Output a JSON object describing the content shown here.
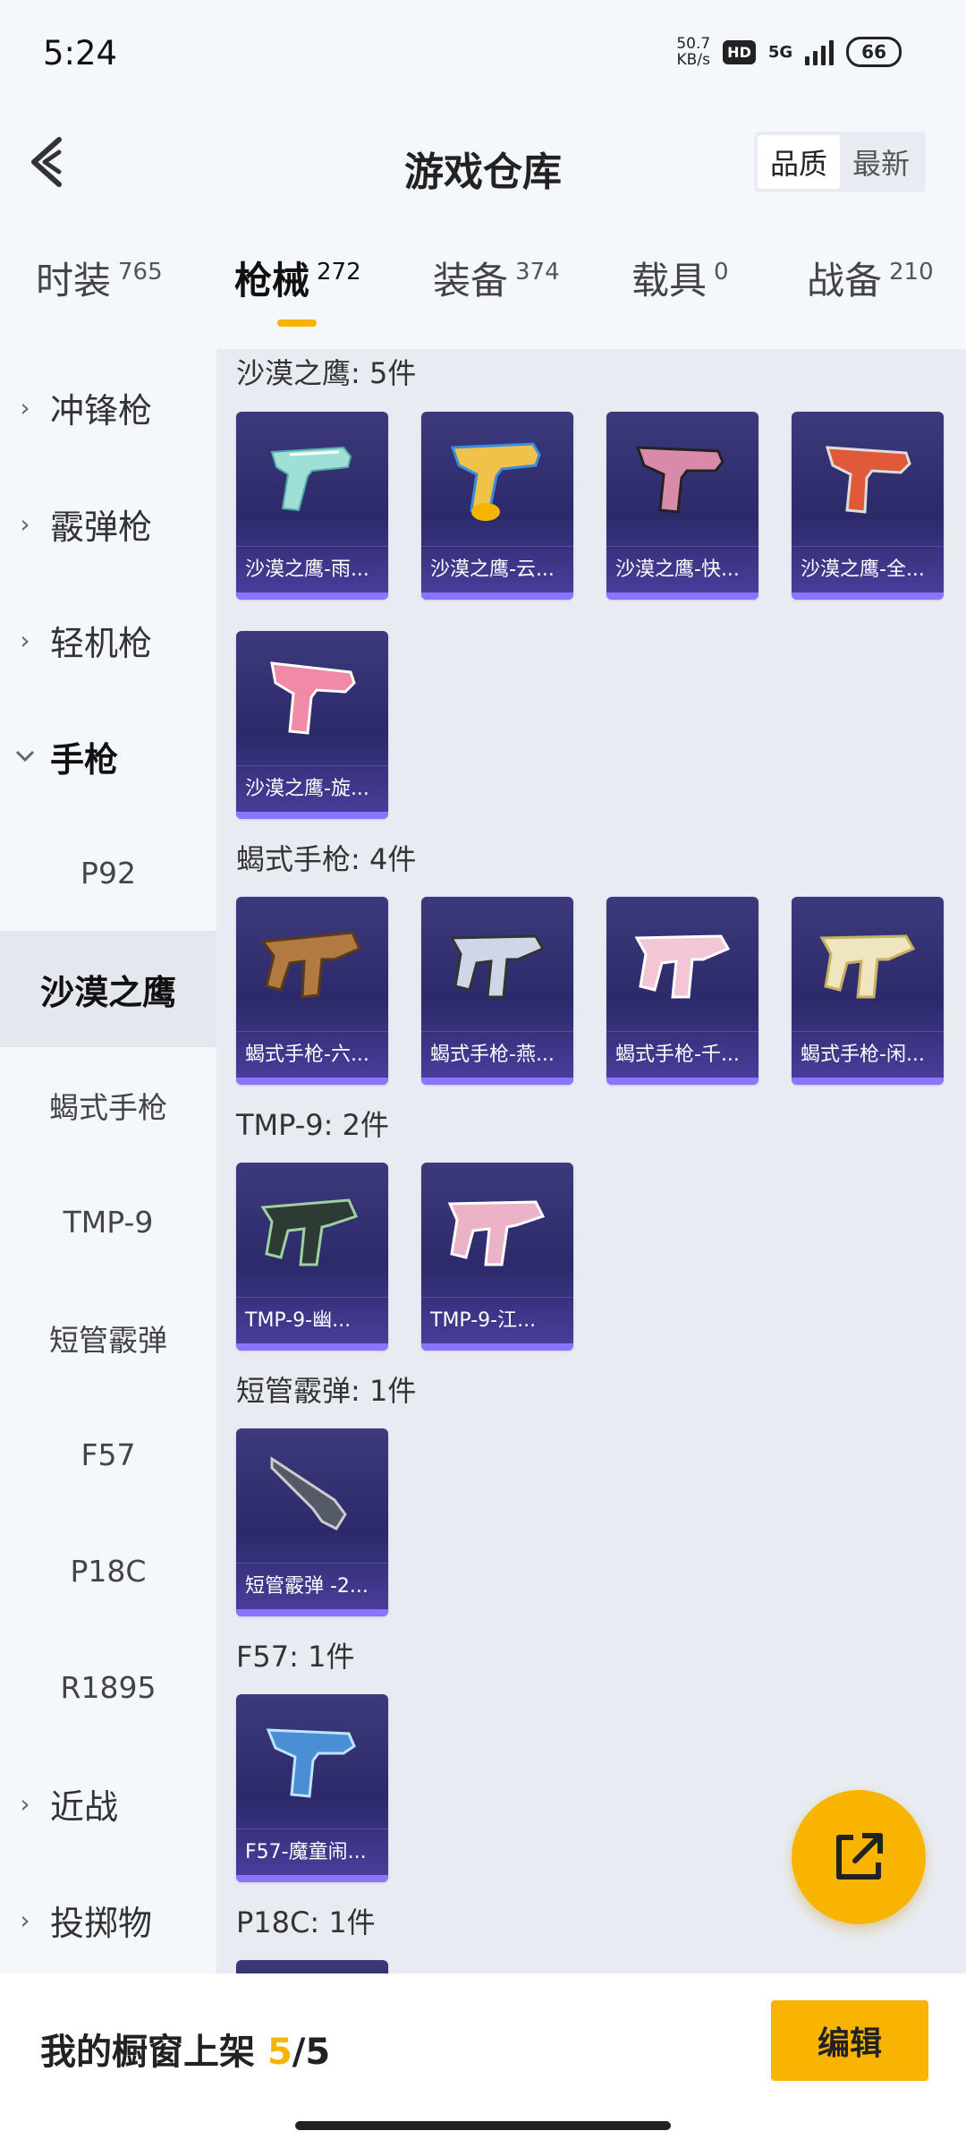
{
  "status_bar": {
    "time": "5:24",
    "speed_value": "50.7",
    "speed_unit": "KB/s",
    "hd": "HD",
    "network": "5G",
    "battery": "66"
  },
  "header": {
    "title": "游戏仓库",
    "sort_options": [
      "品质",
      "最新"
    ],
    "active_sort": "品质"
  },
  "tabs": [
    {
      "label": "时装",
      "count": "765"
    },
    {
      "label": "枪械",
      "count": "272",
      "active": true
    },
    {
      "label": "装备",
      "count": "374"
    },
    {
      "label": "载具",
      "count": "0"
    },
    {
      "label": "战备",
      "count": "210"
    }
  ],
  "sidebar": {
    "groups": [
      "冲锋枪",
      "霰弹枪",
      "轻机枪",
      "手枪",
      "近战",
      "投掷物"
    ],
    "open_group": "手枪",
    "sub_items": [
      "P92",
      "沙漠之鹰",
      "蝎式手枪",
      "TMP-9",
      "短管霰弹",
      "F57",
      "P18C",
      "R1895"
    ],
    "active_sub": "沙漠之鹰"
  },
  "sections": [
    {
      "title": "沙漠之鹰: 5件",
      "items": [
        "沙漠之鹰-雨...",
        "沙漠之鹰-云...",
        "沙漠之鹰-快...",
        "沙漠之鹰-全...",
        "沙漠之鹰-旋..."
      ]
    },
    {
      "title": "蝎式手枪: 4件",
      "items": [
        "蝎式手枪-六...",
        "蝎式手枪-燕...",
        "蝎式手枪-千...",
        "蝎式手枪-闲..."
      ]
    },
    {
      "title": "TMP-9: 2件",
      "items": [
        "TMP-9-幽...",
        "TMP-9-江..."
      ]
    },
    {
      "title": "短管霰弹: 1件",
      "items": [
        "短管霰弹 -2..."
      ]
    },
    {
      "title": "F57: 1件",
      "items": [
        "F57-魔童闹..."
      ]
    },
    {
      "title": "P18C: 1件",
      "items": []
    }
  ],
  "bottom_bar": {
    "showcase_label": "我的橱窗上架",
    "showcase_count": "5",
    "showcase_sep": "/",
    "showcase_total": "5",
    "edit_label": "编辑"
  },
  "colors": {
    "accent": "#f8b400",
    "card_top": "#3c3a7c",
    "card_bottom_stripe": "#8b74ff"
  },
  "icons": {
    "back": "chevron-left-icon",
    "fab": "share-external-icon",
    "sidebar_collapsed": "chevron-right-icon",
    "sidebar_expanded": "chevron-down-icon"
  }
}
